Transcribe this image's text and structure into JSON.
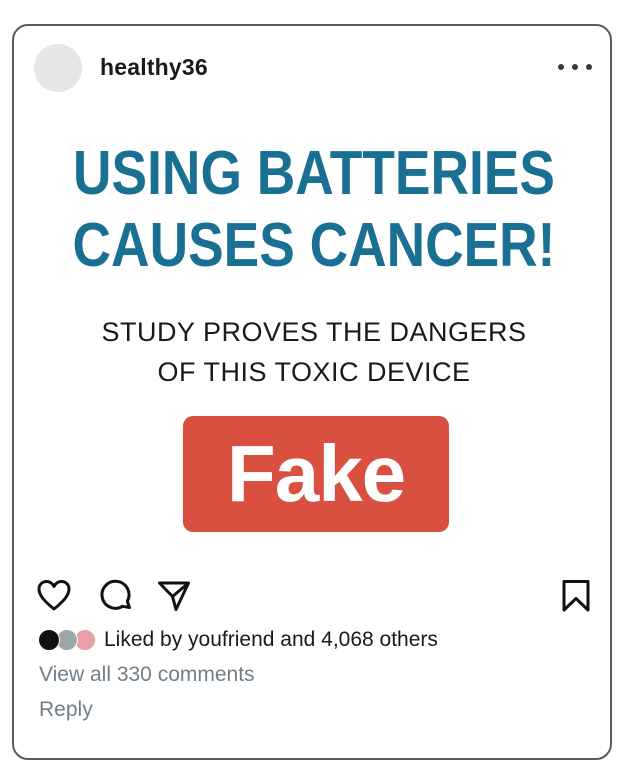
{
  "post": {
    "username": "healthy36",
    "more_icon": "more-horizontal-icon",
    "headline_line1": "USING BATTERIES",
    "headline_line2": "CAUSES CANCER!",
    "subhead_line1": "STUDY PROVES THE DANGERS",
    "subhead_line2": "OF THIS TOXIC DEVICE",
    "badge": "Fake",
    "likes_text": "Liked by youfriend and 4,068 others",
    "comments_link": "View all 330 comments",
    "reply_link": "Reply"
  },
  "actions": {
    "like_icon": "heart-icon",
    "comment_icon": "comment-icon",
    "share_icon": "send-icon",
    "save_icon": "bookmark-icon"
  },
  "colors": {
    "headline": "#1a7092",
    "badge": "#d94f40",
    "link_gray": "#707e8a",
    "face_1": "#111111",
    "face_2": "#9aa8ad",
    "face_3": "#e8a0a4"
  }
}
